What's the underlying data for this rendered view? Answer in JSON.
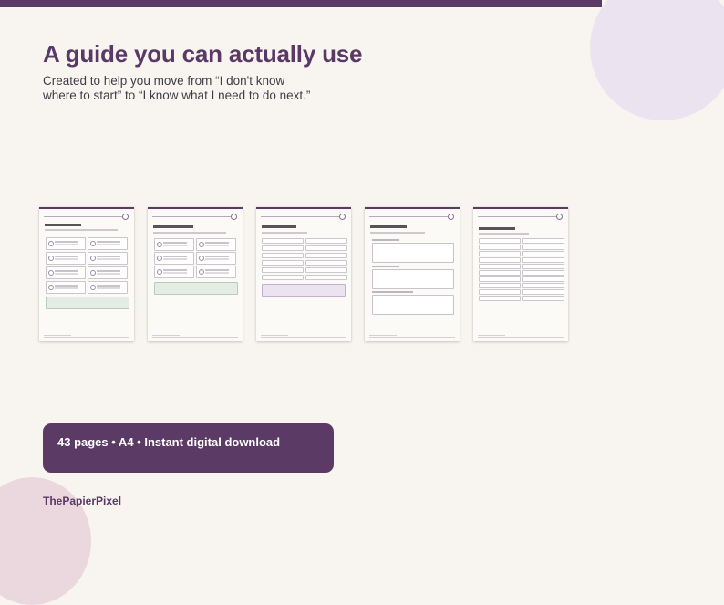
{
  "hero": {
    "title": "A guide you can actually use",
    "subtitle": "Created to help you move from “I don't know where to start” to “I know what I need to do next.”"
  },
  "preview_pages": [
    {
      "id": "page-1"
    },
    {
      "id": "page-2"
    },
    {
      "id": "page-3"
    },
    {
      "id": "page-4"
    },
    {
      "id": "page-5"
    }
  ],
  "banner": {
    "text": "43 pages • A4 • Instant digital download"
  },
  "brand": {
    "name": "ThePapierPixel"
  },
  "colors": {
    "accent": "#5c3a66",
    "background": "#f8f5f0",
    "decor_circle_top": "#ece3f0",
    "decor_circle_bottom": "#ead8de",
    "note_green": "#e4ede5",
    "note_purple": "#ece3f0"
  }
}
